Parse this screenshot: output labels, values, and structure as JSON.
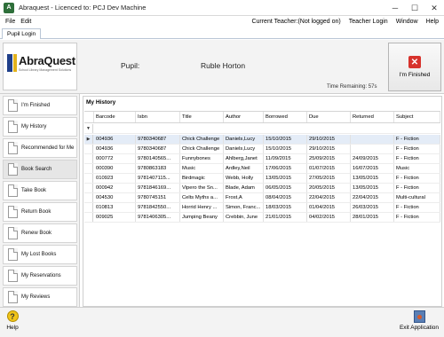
{
  "window": {
    "title": "Abraquest - Licenced to: PCJ Dev Machine",
    "minimize": "─",
    "maximize": "☐",
    "close": "✕"
  },
  "menu": {
    "file": "File",
    "edit": "Edit",
    "current_teacher": "Current Teacher:(Not logged on)",
    "teacher_login": "Teacher Login",
    "window": "Window",
    "help": "Help"
  },
  "tabs": [
    "Pupil Login"
  ],
  "header": {
    "logo_text": "AbraQuest",
    "logo_sub": "School Library Management Solutions",
    "pupil_label": "Pupil:",
    "pupil_name": "Ruble Horton",
    "time_remaining": "Time Remaining: 57s",
    "finished_label": "I'm Finished"
  },
  "sidebar": {
    "items": [
      "I'm Finished",
      "My History",
      "Recommended for Me",
      "Book Search",
      "Take Book",
      "Return Book",
      "Renew Book",
      "My Lost Books",
      "My Reservations",
      "My Reviews"
    ]
  },
  "history": {
    "title": "My History",
    "columns": [
      "Barcode",
      "Isbn",
      "Title",
      "Author",
      "Borrowed",
      "Due",
      "Returned",
      "Subject"
    ],
    "rows": [
      [
        "004936",
        "9780340687",
        "Chick Challenge",
        "Daniels,Lucy",
        "15/10/2015",
        "29/10/2015",
        "",
        "F - Fiction"
      ],
      [
        "004936",
        "9780340687",
        "Chick Challenge",
        "Daniels,Lucy",
        "15/10/2015",
        "29/10/2015",
        "",
        "F - Fiction"
      ],
      [
        "000772",
        "9780140565...",
        "Funnybones",
        "Ahlberg,Janet",
        "11/09/2015",
        "25/09/2015",
        "24/09/2015",
        "F - Fiction"
      ],
      [
        "000390",
        "9780863183",
        "Music",
        "Ardley,Neil",
        "17/06/2015",
        "01/07/2015",
        "16/07/2015",
        "Music"
      ],
      [
        "010923",
        "9781407115...",
        "Birdmagic",
        "Webb, Holly",
        "13/05/2015",
        "27/05/2015",
        "13/05/2015",
        "F - Fiction"
      ],
      [
        "000942",
        "9781846169...",
        "Vipero the Sn...",
        "Blade, Adam",
        "06/05/2015",
        "20/05/2015",
        "13/05/2015",
        "F - Fiction"
      ],
      [
        "004530",
        "9780745151",
        "Celts Myths a...",
        "Frost,A",
        "08/04/2015",
        "22/04/2015",
        "22/04/2015",
        "Multi-cultural"
      ],
      [
        "010813",
        "9781842550...",
        "Horrid Henry ...",
        "Simon, Franc...",
        "18/03/2015",
        "01/04/2015",
        "26/03/2015",
        "F - Fiction"
      ],
      [
        "009025",
        "9781406305...",
        "Jumping Beany",
        "Crebbin, June",
        "21/01/2015",
        "04/02/2015",
        "28/01/2015",
        "F - Fiction"
      ]
    ]
  },
  "footer": {
    "help": "Help",
    "exit": "Exit Application"
  }
}
